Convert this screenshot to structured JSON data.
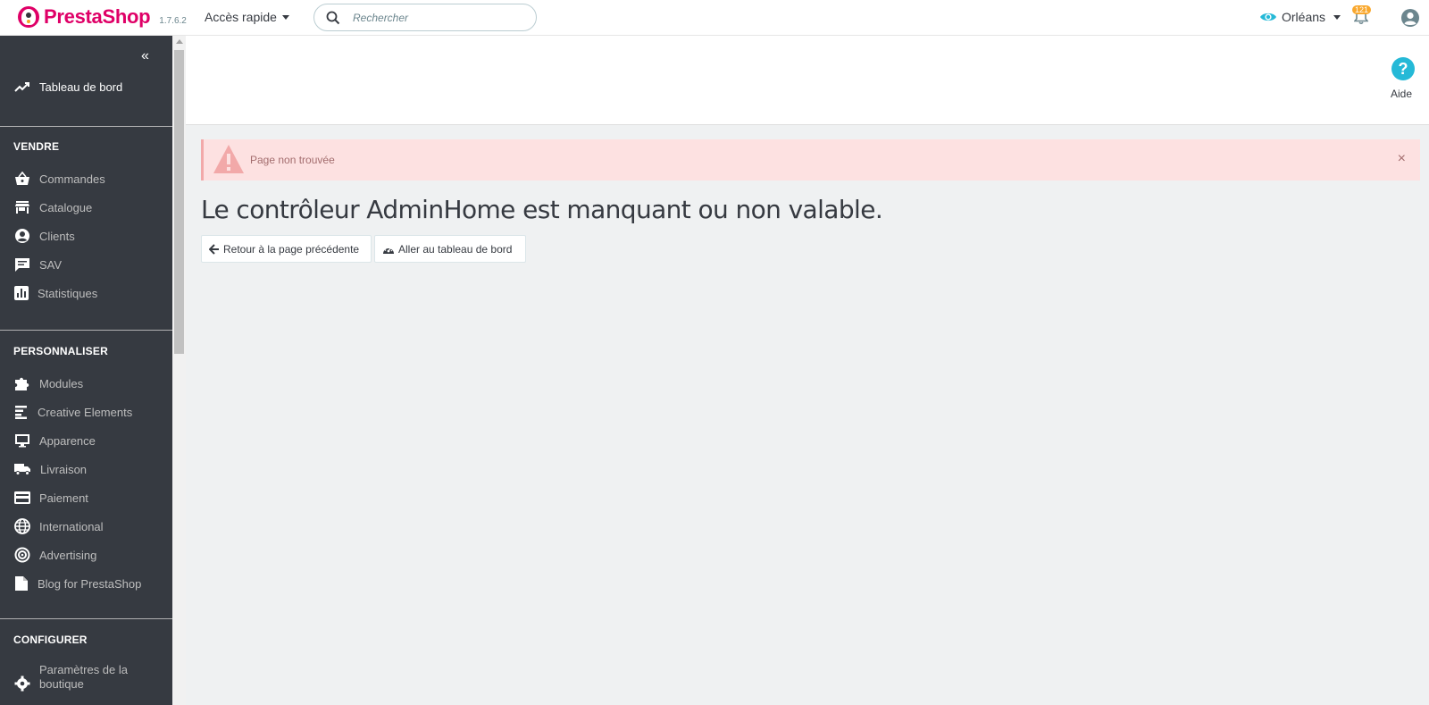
{
  "header": {
    "brand": "PrestaShop",
    "version": "1.7.6.2",
    "quick_access": "Accès rapide",
    "search_placeholder": "Rechercher",
    "shop_name": "Orléans",
    "notifications_count": "121"
  },
  "sidebar": {
    "dashboard": "Tableau de bord",
    "sections": {
      "sell": "VENDRE",
      "customize": "PERSONNALISER",
      "configure": "CONFIGURER"
    },
    "sell_items": [
      "Commandes",
      "Catalogue",
      "Clients",
      "SAV",
      "Statistiques"
    ],
    "customize_items": [
      "Modules",
      "Creative Elements",
      "Apparence",
      "Livraison",
      "Paiement",
      "International",
      "Advertising",
      "Blog for PrestaShop"
    ],
    "configure_items": [
      "Paramètres de la boutique"
    ]
  },
  "toolbar": {
    "help_label": "Aide"
  },
  "main": {
    "alert_text": "Page non trouvée",
    "heading": "Le contrôleur AdminHome est manquant ou non valable.",
    "back_button": "Retour à la page précédente",
    "dashboard_button": "Aller au tableau de bord"
  },
  "colors": {
    "brand": "#df0067",
    "sidebar_bg": "#363a41",
    "accent": "#25b9d7",
    "alert_bg": "#fde1e1",
    "badge": "#f9a82e"
  }
}
